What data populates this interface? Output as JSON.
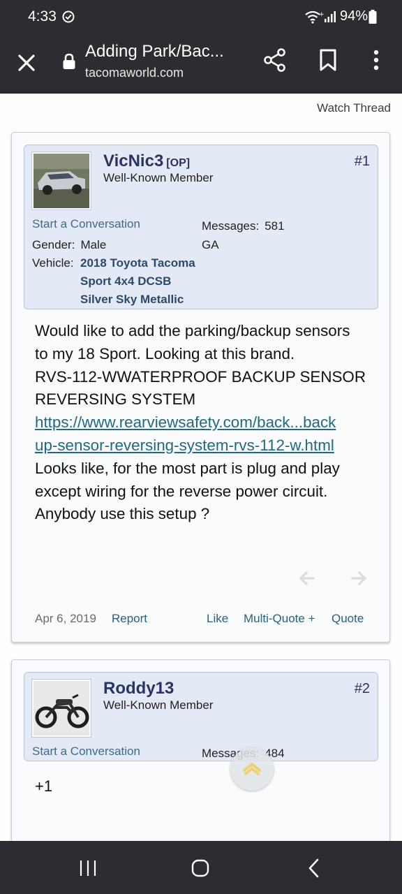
{
  "status_bar": {
    "time": "4:33",
    "battery": "94%"
  },
  "browser": {
    "title": "Adding Park/Bac...",
    "domain": "tacomaworld.com"
  },
  "thread": {
    "watch_label": "Watch Thread"
  },
  "posts": [
    {
      "username": "VicNic3",
      "op_tag": "[OP]",
      "user_title": "Well-Known Member",
      "post_number": "#1",
      "start_conversation": "Start a Conversation",
      "messages_label": "Messages:",
      "messages_value": "581",
      "location": "GA",
      "gender_label": "Gender:",
      "gender_value": "Male",
      "vehicle_label": "Vehicle:",
      "vehicle_lines": [
        "2018 Toyota Tacoma",
        "Sport 4x4 DCSB",
        "Silver Sky Metallic"
      ],
      "body_lines": [
        "Would like to add the parking/backup sensors",
        "to my 18 Sport. Looking at this brand.",
        "RVS-112-WWATERPROOF BACKUP SENSOR",
        "REVERSING SYSTEM"
      ],
      "link_lines": [
        "https://www.rearviewsafety.com/back...back",
        "up-sensor-reversing-system-rvs-112-w.html"
      ],
      "body_lines_after": [
        "Looks like, for the most part is plug and play",
        "except wiring for the reverse power circuit.",
        "Anybody use this setup ?"
      ],
      "date": "Apr 6, 2019",
      "report": "Report",
      "like": "Like",
      "multi_quote": "Multi-Quote +",
      "quote": "Quote"
    },
    {
      "username": "Roddy13",
      "user_title": "Well-Known Member",
      "post_number": "#2",
      "start_conversation": "Start a Conversation",
      "messages_label": "Messages:",
      "messages_value": "484",
      "body": "+1"
    }
  ],
  "colors": {
    "system_bar": "#2b2d31",
    "username": "#2b3362",
    "userbox": "#e3eaf5",
    "link": "#216983"
  }
}
